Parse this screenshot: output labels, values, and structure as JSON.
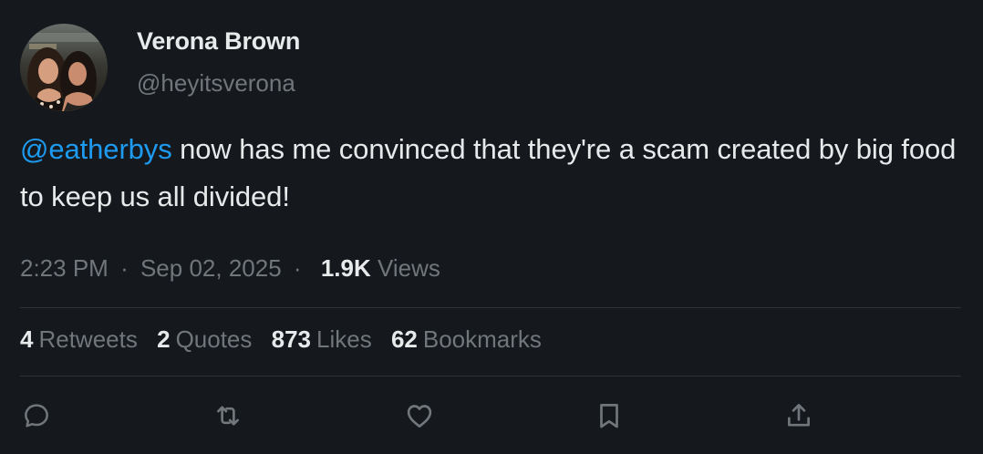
{
  "author": {
    "name": "Verona Brown",
    "handle": "@heyitsverona"
  },
  "tweet": {
    "mention": "@eatherbys",
    "text": " now has me convinced that they're a scam created by big food to keep us all divided!"
  },
  "meta": {
    "time": "2:23 PM",
    "separator": "·",
    "date": "Sep 02, 2025",
    "views_count": "1.9K",
    "views_label": "Views"
  },
  "stats": {
    "retweets_count": "4",
    "retweets_label": "Retweets",
    "quotes_count": "2",
    "quotes_label": "Quotes",
    "likes_count": "873",
    "likes_label": "Likes",
    "bookmarks_count": "62",
    "bookmarks_label": "Bookmarks"
  },
  "actions": {
    "icons": [
      "reply-icon",
      "retweet-icon",
      "like-icon",
      "bookmark-icon",
      "share-icon"
    ]
  },
  "colors": {
    "background": "#15181d",
    "text": "#e7e9ea",
    "secondary": "#71767b",
    "accent": "#1d9bf0",
    "divider": "#2f3336"
  }
}
